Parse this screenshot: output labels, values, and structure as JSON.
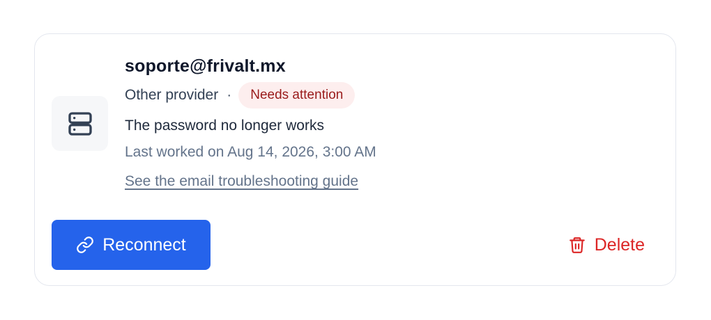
{
  "account": {
    "email": "soporte@frivalt.mx",
    "provider": "Other provider",
    "separator": "·",
    "status_badge": "Needs attention",
    "problem": "The password no longer works",
    "last_worked": "Last worked on Aug 14, 2026, 3:00 AM",
    "guide_link": "See the email troubleshooting guide",
    "icon": "server-icon"
  },
  "actions": {
    "reconnect_label": "Reconnect",
    "reconnect_icon": "link-icon",
    "delete_label": "Delete",
    "delete_icon": "trash-icon"
  },
  "colors": {
    "primary": "#2563eb",
    "danger": "#dc2626",
    "badge_bg": "#fdeeee",
    "badge_text": "#991b1b"
  }
}
